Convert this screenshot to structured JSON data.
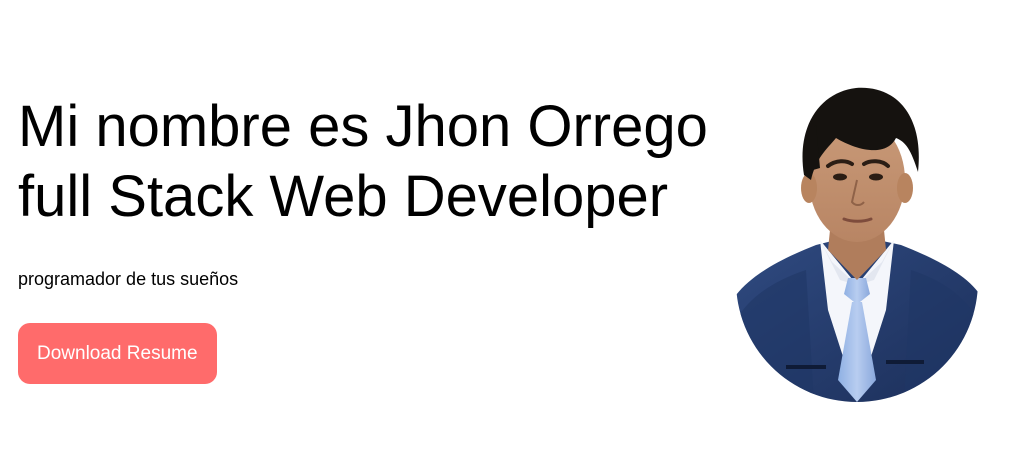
{
  "hero": {
    "headline_line1": "Mi nombre es Jhon Orrego",
    "headline_line2": "full Stack Web Developer",
    "tagline": "programador de tus sueños",
    "download_label": "Download Resume"
  },
  "colors": {
    "button_bg": "#ff6b6b",
    "button_text": "#ffffff",
    "text": "#000000",
    "background": "#ffffff"
  },
  "portrait": {
    "icon": "profile-photo"
  }
}
